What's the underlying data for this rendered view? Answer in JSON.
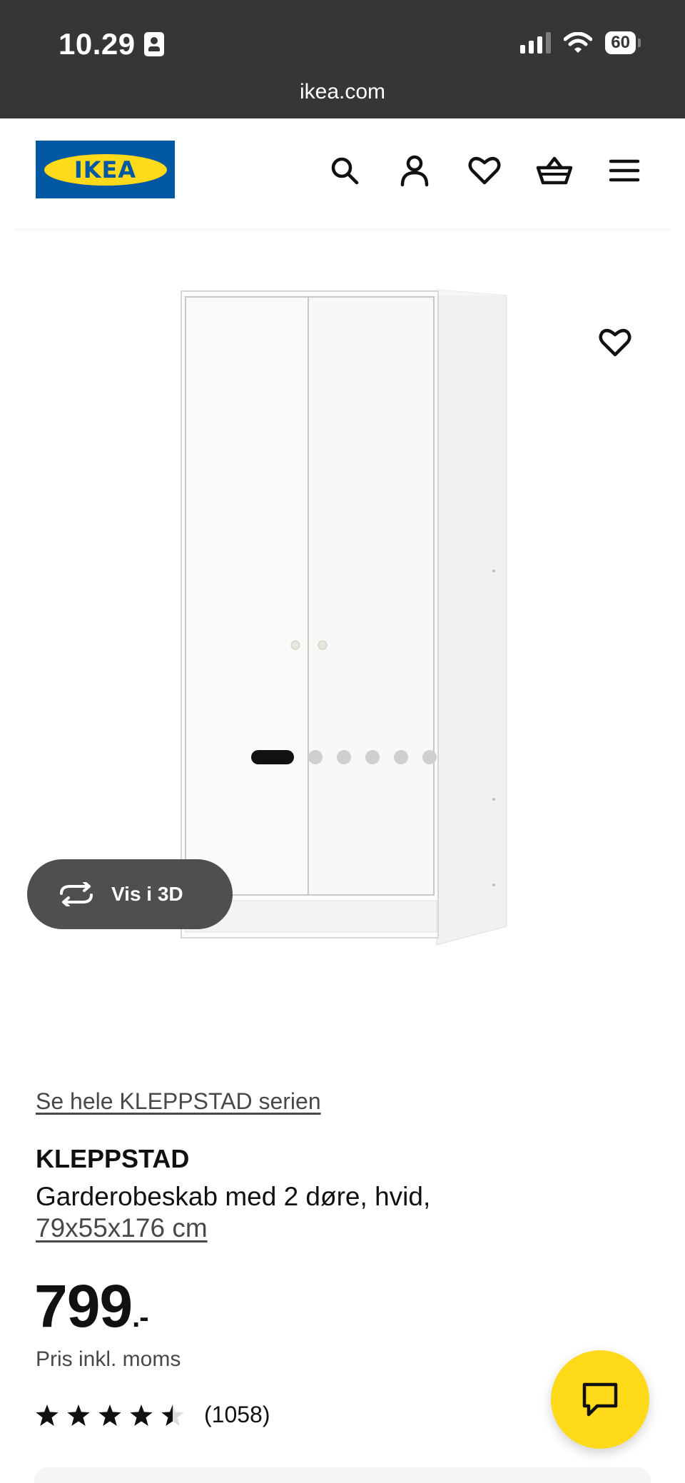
{
  "status_bar": {
    "time": "10.29",
    "battery": "60"
  },
  "browser": {
    "url": "ikea.com"
  },
  "header": {
    "logo_text": "IKEA",
    "icons": [
      "search-icon",
      "profile-icon",
      "heart-icon",
      "basket-icon",
      "menu-icon"
    ]
  },
  "media": {
    "view_3d_label": "Vis i 3D",
    "image_count": 6,
    "active_image": 1
  },
  "product": {
    "series_link": "Se hele KLEPPSTAD serien",
    "name": "KLEPPSTAD",
    "description": "Garderobeskab med 2 døre, hvid,",
    "size": "79x55x176 cm",
    "price_main": "799",
    "price_suffix": ".-",
    "price_note": "Pris inkl. moms",
    "rating": 4.5,
    "rating_max": 5,
    "review_count": "(1058)"
  },
  "colors": {
    "brand_blue": "#0058a3",
    "brand_yellow": "#ffda1a"
  }
}
